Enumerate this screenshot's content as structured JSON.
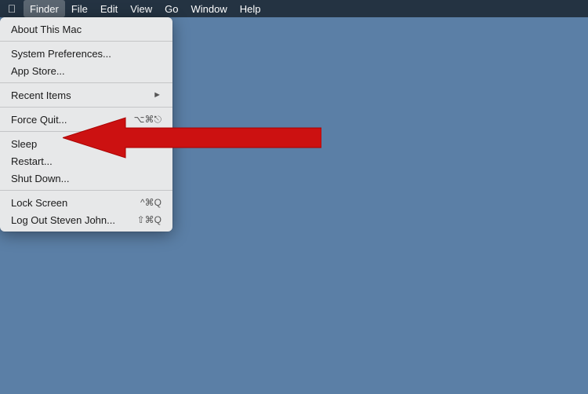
{
  "menubar": {
    "apple_symbol": "",
    "items": [
      {
        "label": "Finder",
        "active": true
      },
      {
        "label": "File"
      },
      {
        "label": "Edit"
      },
      {
        "label": "View"
      },
      {
        "label": "Go"
      },
      {
        "label": "Window"
      },
      {
        "label": "Help"
      }
    ]
  },
  "dropdown": {
    "items": [
      {
        "id": "about",
        "label": "About This Mac",
        "shortcut": "",
        "has_arrow": false,
        "separator_before": false
      },
      {
        "id": "sep1",
        "type": "separator"
      },
      {
        "id": "system_prefs",
        "label": "System Preferences...",
        "shortcut": "",
        "has_arrow": false,
        "separator_before": false
      },
      {
        "id": "app_store",
        "label": "App Store...",
        "shortcut": "",
        "has_arrow": false,
        "separator_before": false
      },
      {
        "id": "sep2",
        "type": "separator"
      },
      {
        "id": "recent_items",
        "label": "Recent Items",
        "shortcut": "",
        "has_arrow": true,
        "separator_before": false
      },
      {
        "id": "sep3",
        "type": "separator"
      },
      {
        "id": "force_quit",
        "label": "Force Quit...",
        "shortcut": "⌥⌘⎋",
        "has_arrow": false,
        "separator_before": false
      },
      {
        "id": "sep4",
        "type": "separator"
      },
      {
        "id": "sleep",
        "label": "Sleep",
        "shortcut": "",
        "has_arrow": false,
        "separator_before": false
      },
      {
        "id": "restart",
        "label": "Restart...",
        "shortcut": "",
        "has_arrow": false,
        "separator_before": false
      },
      {
        "id": "shutdown",
        "label": "Shut Down...",
        "shortcut": "",
        "has_arrow": false,
        "separator_before": false
      },
      {
        "id": "sep5",
        "type": "separator"
      },
      {
        "id": "lock_screen",
        "label": "Lock Screen",
        "shortcut": "^⌘Q",
        "has_arrow": false,
        "separator_before": false
      },
      {
        "id": "logout",
        "label": "Log Out Steven John...",
        "shortcut": "⇧⌘Q",
        "has_arrow": false,
        "separator_before": false
      }
    ]
  }
}
